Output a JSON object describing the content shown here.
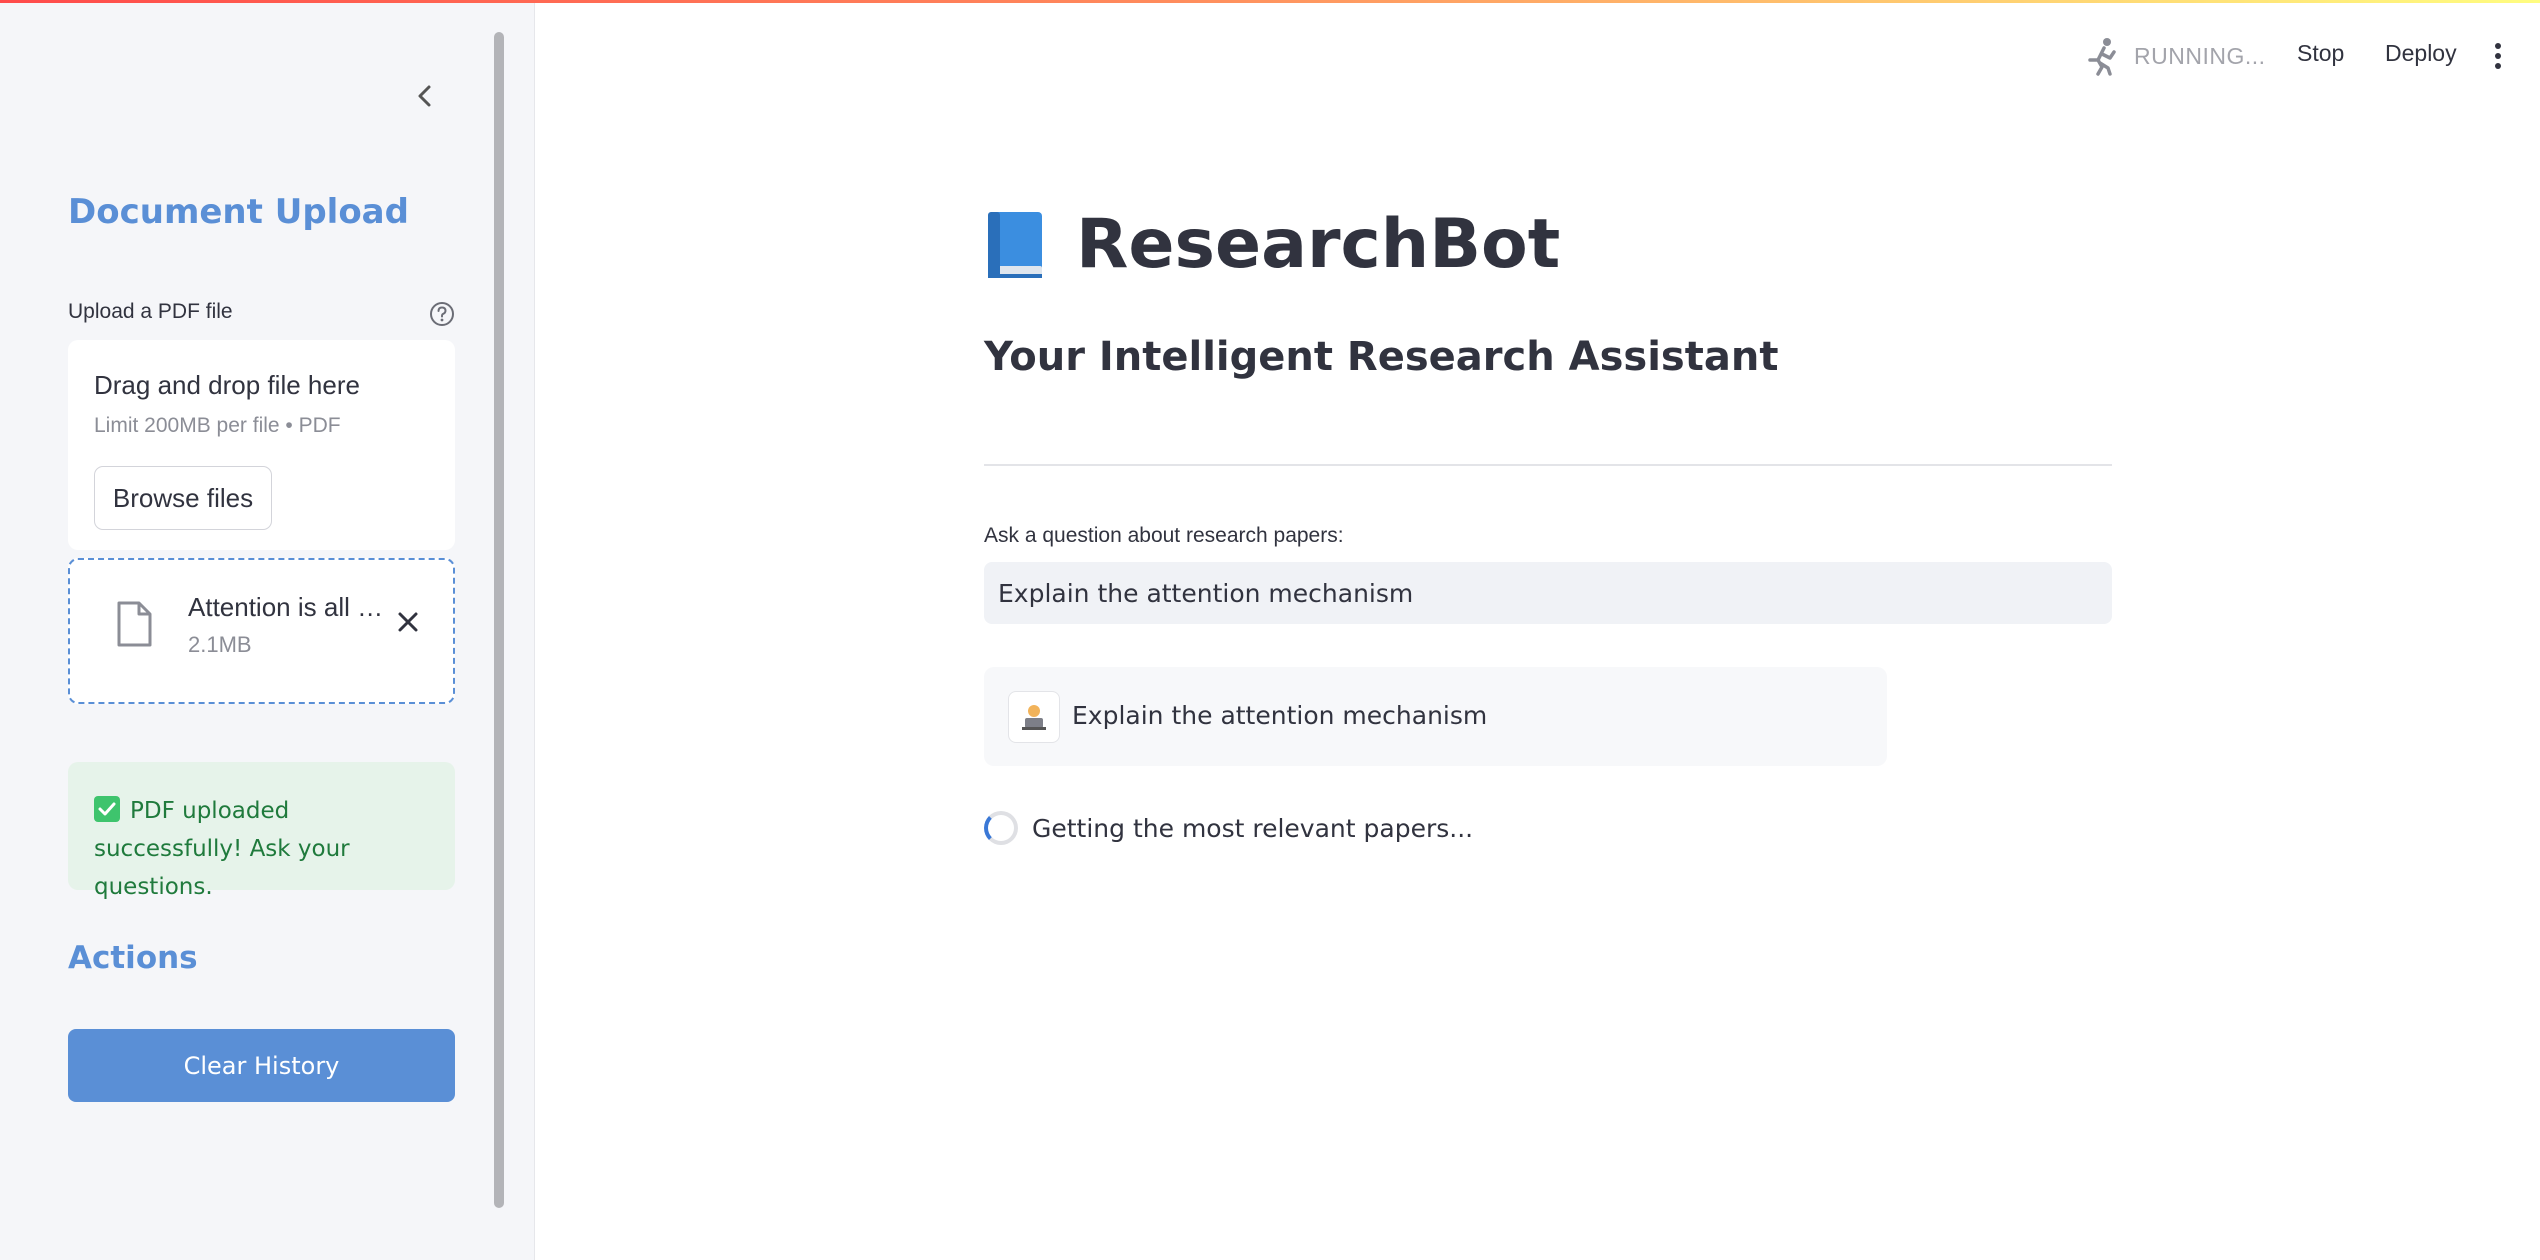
{
  "sidebar": {
    "heading": "Document Upload",
    "uploader_label": "Upload a PDF file",
    "dropzone": {
      "title": "Drag and drop file here",
      "limit": "Limit 200MB per file • PDF",
      "browse_label": "Browse files"
    },
    "file": {
      "name": "Attention is all you need.pdf",
      "size": "2.1MB"
    },
    "success_message": "PDF uploaded successfully! Ask your questions.",
    "actions_heading": "Actions",
    "clear_label": "Clear History"
  },
  "header": {
    "status": "RUNNING...",
    "stop_label": "Stop",
    "deploy_label": "Deploy"
  },
  "main": {
    "title": "ResearchBot",
    "subtitle": "Your Intelligent Research Assistant",
    "question_label": "Ask a question about research papers:",
    "question_value": "Explain the attention mechanism",
    "chat_message": "Explain the attention mechanism",
    "spinner_text": "Getting the most relevant papers..."
  },
  "colors": {
    "accent": "#5a8fd6",
    "success_bg": "#e6f3ea",
    "success_text": "#1f7a3c"
  },
  "icons": {
    "collapse": "chevron-left-icon",
    "help": "question-circle-icon",
    "file": "document-icon",
    "close": "close-icon",
    "success": "check-box-icon",
    "running": "running-person-icon",
    "menu": "kebab-menu-icon",
    "logo": "blue-book-icon",
    "avatar": "user-avatar-icon"
  }
}
